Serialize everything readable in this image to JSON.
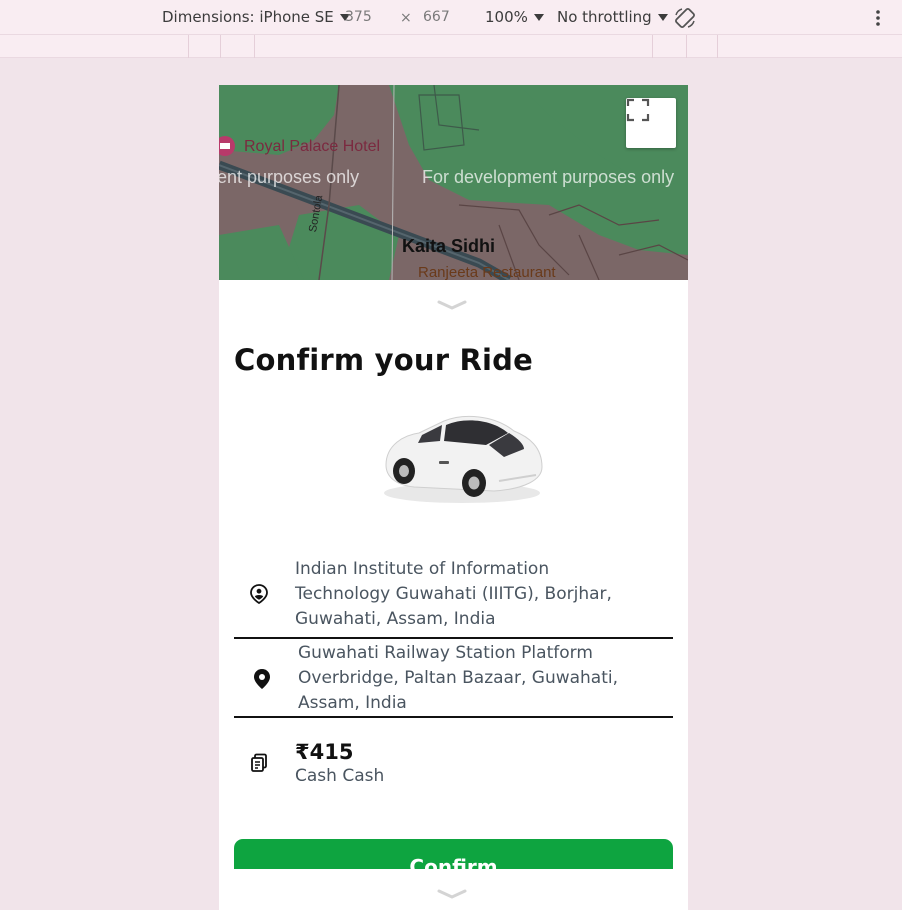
{
  "devtools": {
    "dimensions_label": "Dimensions: iPhone SE",
    "width": "375",
    "times": "×",
    "height": "667",
    "zoom": "100%",
    "throttling": "No throttling"
  },
  "map": {
    "hotel": "Royal Palace Hotel",
    "watermark_left": "ent purposes only",
    "watermark_right": "For development purposes only",
    "locality": "Kaita Sidhi",
    "restaurant": "Ranjeeta Restaurant",
    "road": "Sontola",
    "colors": {
      "land": "#7b6767",
      "park": "#4b8a5c",
      "road": "#3a4a52"
    }
  },
  "ride": {
    "title": "Confirm your Ride",
    "pickup": "Indian Institute of Information Technology Guwahati (IIITG), Borjhar, Guwahati, Assam, India",
    "destination": "Guwahati Railway Station Platform Overbridge, Paltan Bazaar, Guwahati, Assam, India",
    "fare": "₹415",
    "payment": "Cash Cash",
    "confirm_label": "Confirm"
  },
  "icons": {
    "pickup": "user-location-icon",
    "destination": "map-pin-icon",
    "fare": "cash-icon",
    "fullscreen": "fullscreen-icon",
    "handle": "chevron-down-icon",
    "rotate": "rotate-icon",
    "more": "more-vertical-icon"
  },
  "theme": {
    "accent": "#0ea440"
  }
}
